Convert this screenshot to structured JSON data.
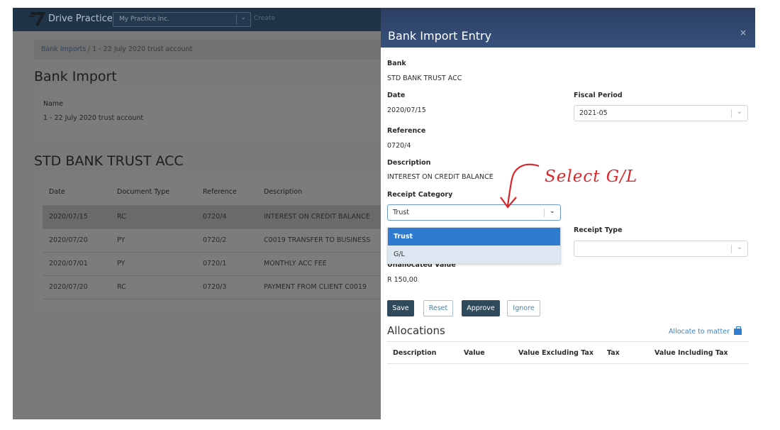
{
  "app": {
    "brand": "Drive Practice",
    "company": "My Practice Inc.",
    "create_label": "Create",
    "breadcrumb": {
      "link": "Bank Imports",
      "rest": "/  1 - 22 July 2020 trust account"
    },
    "page_title": "Bank Import",
    "name_label": "Name",
    "name_value": "1 - 22 July 2020 trust account",
    "account_title": "STD BANK TRUST ACC",
    "table": {
      "headers": [
        "Date",
        "Document Type",
        "Reference",
        "Description"
      ],
      "rows": [
        [
          "2020/07/15",
          "RC",
          "0720/4",
          "INTEREST ON CREDIT BALANCE"
        ],
        [
          "2020/07/20",
          "PY",
          "0720/2",
          "C0019 TRANSFER TO BUSINESS"
        ],
        [
          "2020/07/01",
          "PY",
          "0720/1",
          "MONTHLY ACC FEE"
        ],
        [
          "2020/07/20",
          "RC",
          "0720/3",
          "PAYMENT FROM CLIENT C0019"
        ]
      ]
    }
  },
  "modal": {
    "title": "Bank Import Entry",
    "close": "×",
    "bank_label": "Bank",
    "bank_value": "STD BANK TRUST ACC",
    "date_label": "Date",
    "date_value": "2020/07/15",
    "fiscal_label": "Fiscal Period",
    "fiscal_value": "2021-05",
    "reference_label": "Reference",
    "reference_value": "0720/4",
    "description_label": "Description",
    "description_value": "INTEREST ON CREDIT BALANCE",
    "receipt_category_label": "Receipt Category",
    "receipt_category_value": "Trust",
    "receipt_category_options": [
      "Trust",
      "G/L"
    ],
    "receipt_type_label": "Receipt Type",
    "receipt_type_value": "",
    "unallocated_label": "Unallocated Value",
    "unallocated_value": "R 150,00",
    "buttons": {
      "save": "Save",
      "reset": "Reset",
      "approve": "Approve",
      "ignore": "Ignore"
    },
    "allocations_title": "Allocations",
    "allocate_link": "Allocate to matter",
    "alloc_headers": [
      "Description",
      "Value",
      "Value Excluding Tax",
      "Tax",
      "Value Including Tax"
    ]
  },
  "annotation": {
    "text": "Select G/L",
    "color": "#d9262b"
  }
}
